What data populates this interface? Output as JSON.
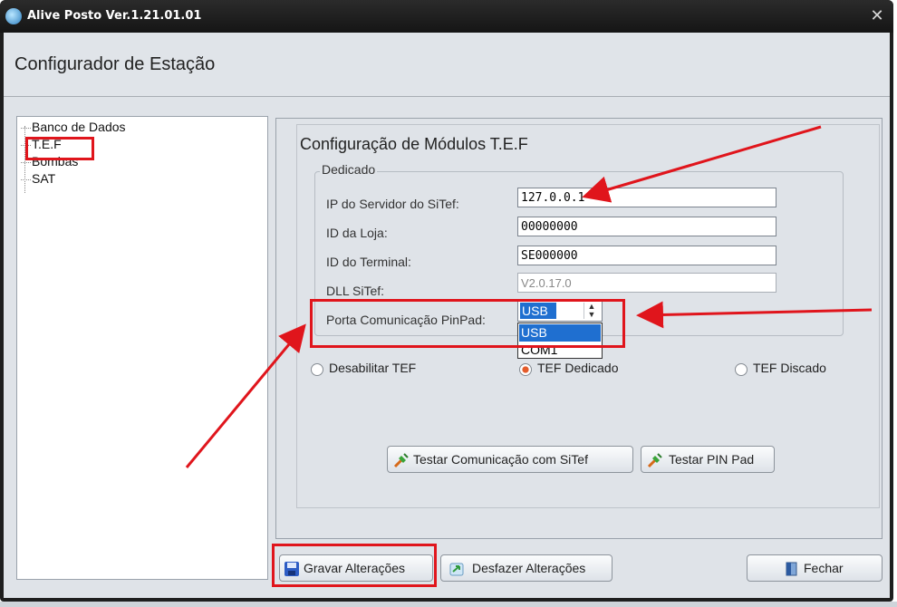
{
  "window": {
    "title": "Alive Posto Ver.1.21.01.01",
    "close_glyph": "✕"
  },
  "header": {
    "title": "Configurador de Estação"
  },
  "tree": {
    "items": [
      {
        "label": "Banco de Dados"
      },
      {
        "label": "T.E.F"
      },
      {
        "label": "Bombas"
      },
      {
        "label": "SAT"
      }
    ]
  },
  "panel": {
    "title": "Configuração de Módulos T.E.F",
    "group_title": "Dedicado",
    "fields": {
      "ip": {
        "label": "IP do Servidor do SiTef:",
        "value": "127.0.0.1"
      },
      "loja": {
        "label": "ID da Loja:",
        "value": "00000000"
      },
      "terminal": {
        "label": "ID do Terminal:",
        "value": "SE000000"
      },
      "dll": {
        "label": "DLL SiTef:",
        "value": "V2.0.17.0"
      },
      "porta": {
        "label": "Porta Comunicação PinPad:",
        "value": "USB",
        "options": [
          "USB",
          "COM1"
        ]
      }
    },
    "radios": {
      "desabilitar": "Desabilitar TEF",
      "dedicado": "TEF Dedicado",
      "discado": "TEF Discado",
      "selected": "dedicado"
    },
    "buttons": {
      "testar_sitef": "Testar Comunicação com SiTef",
      "testar_pinpad": "Testar PIN Pad"
    }
  },
  "footer": {
    "gravar": "Gravar Alterações",
    "desfazer": "Desfazer Alterações",
    "fechar": "Fechar"
  },
  "colors": {
    "highlight_red": "#e0151c",
    "selection_blue": "#1f6fd0",
    "titlebar": "#1e1e1e"
  }
}
